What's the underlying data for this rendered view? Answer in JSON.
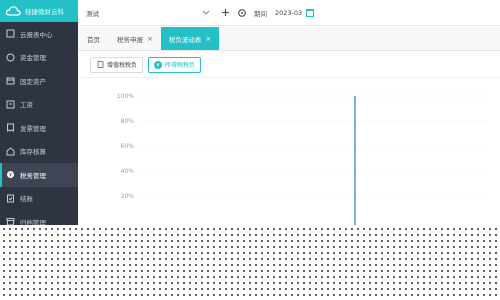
{
  "brand": {
    "name": "轻捷微财云科"
  },
  "sidebar": {
    "items": [
      {
        "label": "云报表中心",
        "icon": "report-icon"
      },
      {
        "label": "资金管理",
        "icon": "money-icon"
      },
      {
        "label": "固定资产",
        "icon": "asset-icon"
      },
      {
        "label": "工资",
        "icon": "salary-icon"
      },
      {
        "label": "发票管理",
        "icon": "invoice-icon"
      },
      {
        "label": "库存核算",
        "icon": "inventory-icon"
      },
      {
        "label": "税务管理",
        "icon": "tax-icon",
        "active": true
      },
      {
        "label": "结账",
        "icon": "close-book-icon"
      },
      {
        "label": "归档管理",
        "icon": "archive-icon"
      }
    ]
  },
  "topbar": {
    "company": "测试",
    "period_label": "期间",
    "period_value": "2023-03"
  },
  "tabs": [
    {
      "label": "首页",
      "closable": false,
      "active": false
    },
    {
      "label": "税务申报",
      "closable": true,
      "active": false
    },
    {
      "label": "税负波动表",
      "closable": true,
      "active": true
    }
  ],
  "subtabs": [
    {
      "label": "增值税税负",
      "active": false
    },
    {
      "label": "所得税税负",
      "active": true
    }
  ],
  "chart_data": {
    "type": "bar",
    "y_ticks": [
      "100%",
      "80%",
      "60%",
      "40%",
      "20%"
    ],
    "ylim": [
      0,
      100
    ],
    "ylabel": "",
    "xlabel": "",
    "title": "",
    "series_color": "#5b9bd5"
  },
  "colors": {
    "accent": "#23c1c7",
    "sidebar_bg": "#2f3443"
  }
}
